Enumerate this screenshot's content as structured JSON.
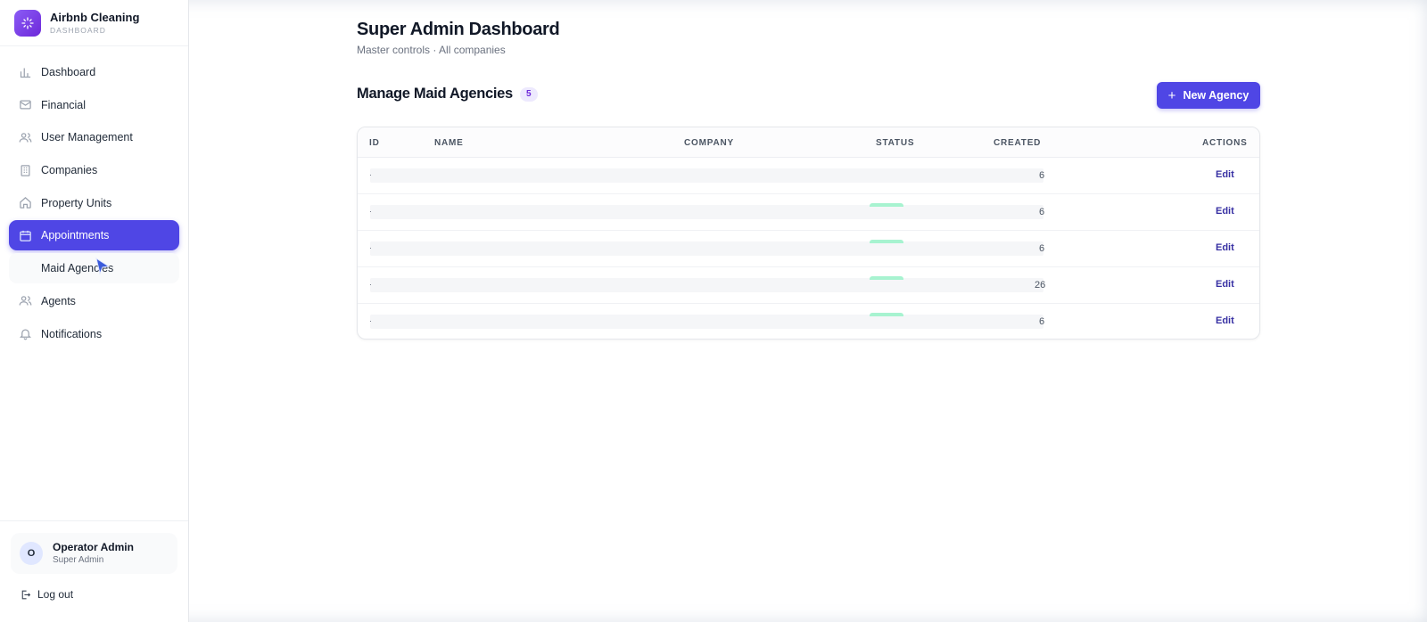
{
  "brand": {
    "name": "Airbnb Cleaning",
    "subtitle": "DASHBOARD",
    "logo_icon": "sparkles-icon"
  },
  "sidebar": {
    "items": [
      {
        "label": "Dashboard",
        "icon": "bar-chart-icon"
      },
      {
        "label": "Financial",
        "icon": "mail-icon"
      },
      {
        "label": "User Management",
        "icon": "users-icon"
      },
      {
        "label": "Companies",
        "icon": "building-icon"
      },
      {
        "label": "Property Units",
        "icon": "home-icon"
      },
      {
        "label": "Appointments",
        "icon": "calendar-icon",
        "active": true
      },
      {
        "label": "Maid Agencies",
        "icon": "agency-icon",
        "hovered": true
      },
      {
        "label": "Agents",
        "icon": "users-icon"
      },
      {
        "label": "Notifications",
        "icon": "bell-icon"
      }
    ],
    "user": {
      "initial": "O",
      "name": "Operator Admin",
      "role": "Super Admin"
    },
    "logout_label": "Log out"
  },
  "page": {
    "title": "Super Admin Dashboard",
    "subtitle": "Master controls · All companies"
  },
  "section": {
    "title": "Manage Maid Agencies",
    "count": "5",
    "new_button_label": "New Agency"
  },
  "table": {
    "columns": [
      "ID",
      "NAME",
      "COMPANY",
      "STATUS",
      "CREATED",
      "ACTIONS"
    ],
    "rows": [
      {
        "id_fragment": "·",
        "created_fragment": "6",
        "action": "Edit"
      },
      {
        "id_fragment": "·",
        "created_fragment": "6",
        "action": "Edit"
      },
      {
        "id_fragment": "·",
        "created_fragment": "6",
        "action": "Edit"
      },
      {
        "id_fragment": "·",
        "created_fragment": "26",
        "action": "Edit"
      },
      {
        "id_fragment": "·",
        "created_fragment": "6",
        "action": "Edit"
      }
    ]
  },
  "colors": {
    "accent": "#4f46e5",
    "badge_bg": "#ede9fe",
    "status_active": "#a7f3d0"
  }
}
